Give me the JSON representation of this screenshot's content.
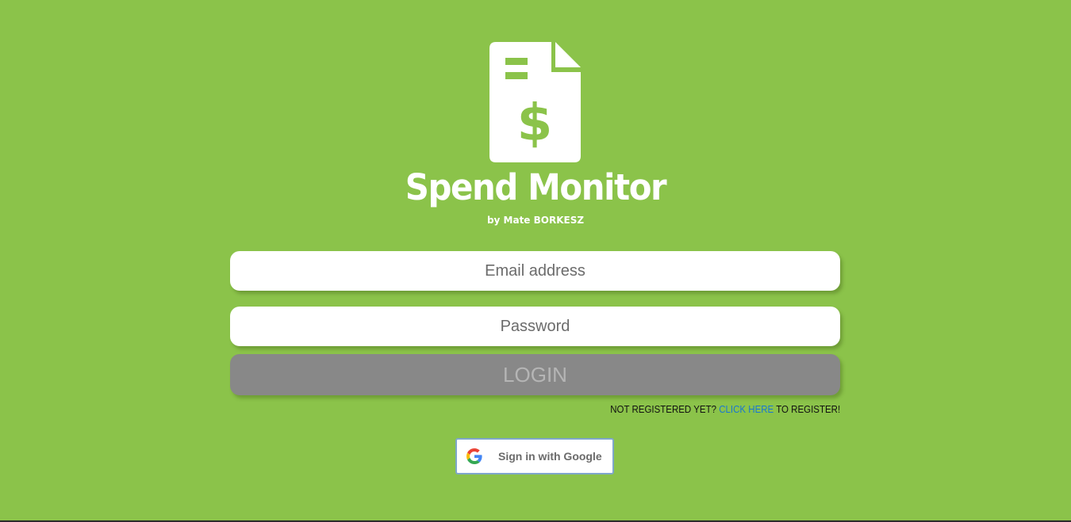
{
  "brand": {
    "title": "Spend Monitor",
    "author": "by Mate BORKESZ",
    "logo_icon": "invoice-dollar-icon",
    "background_color": "#8bc34a"
  },
  "form": {
    "email_placeholder": "Email address",
    "password_placeholder": "Password",
    "login_label": "LOGIN"
  },
  "register": {
    "prefix": "NOT REGISTERED YET? ",
    "link_text": "CLICK HERE",
    "suffix": " TO REGISTER!"
  },
  "google": {
    "label": "Sign in with Google",
    "icon": "google-icon"
  }
}
